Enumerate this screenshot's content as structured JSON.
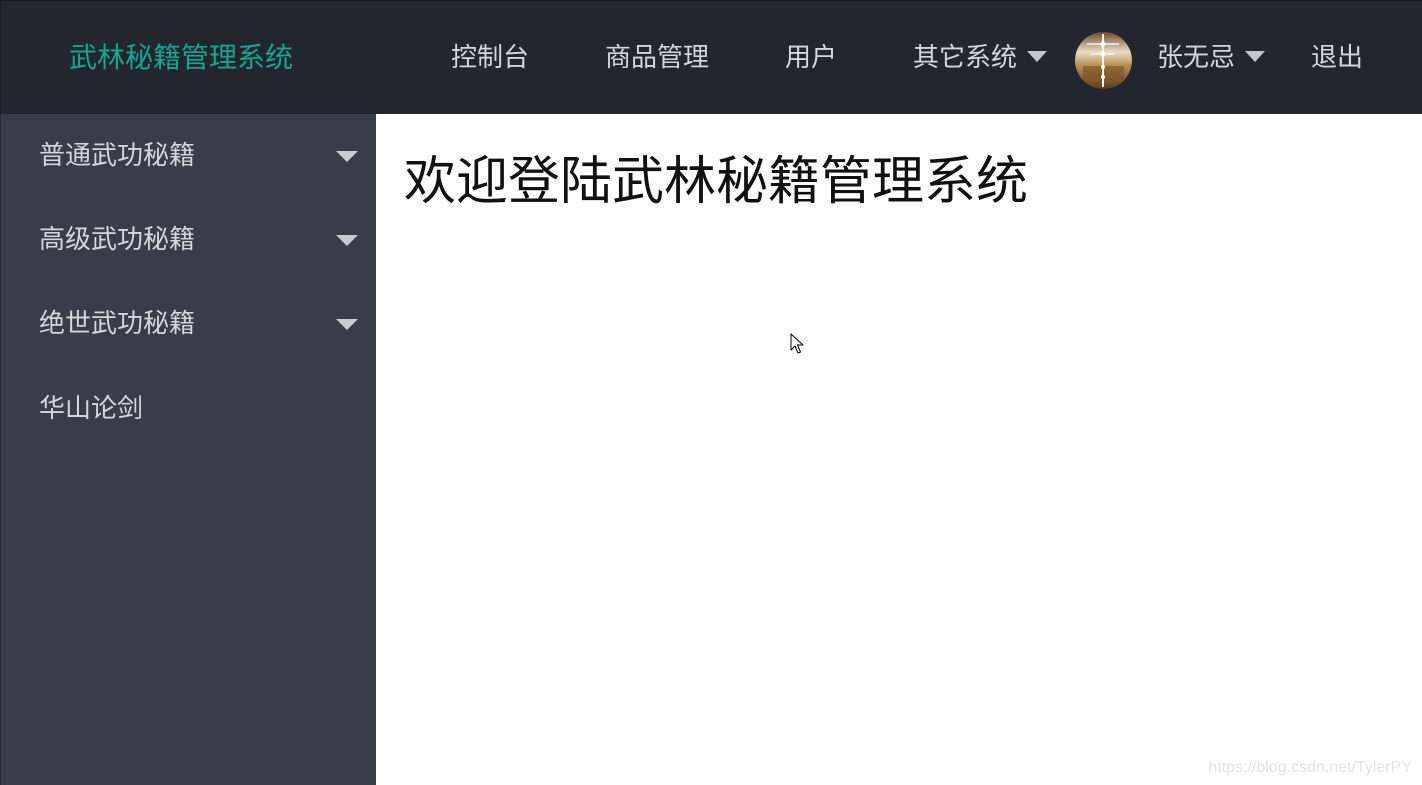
{
  "header": {
    "logo": "武林秘籍管理系统",
    "nav": {
      "console": "控制台",
      "products": "商品管理",
      "users": "用户",
      "other_systems": "其它系统",
      "username": "张无忌",
      "logout": "退出"
    }
  },
  "sidebar": {
    "items": [
      {
        "label": "普通武功秘籍",
        "has_submenu": true
      },
      {
        "label": "高级武功秘籍",
        "has_submenu": true
      },
      {
        "label": "绝世武功秘籍",
        "has_submenu": true
      },
      {
        "label": "华山论剑",
        "has_submenu": false
      }
    ]
  },
  "main": {
    "welcome": "欢迎登陆武林秘籍管理系统"
  },
  "watermark": "https://blog.csdn.net/TylerPY",
  "colors": {
    "header_bg": "#23262e",
    "sidebar_bg": "#393d49",
    "logo_accent": "#15a593",
    "nav_text": "#d4d6d9"
  },
  "icons": {
    "dropdown": "caret-down-icon",
    "avatar": "user-avatar",
    "pointer": "mouse-pointer-icon"
  }
}
